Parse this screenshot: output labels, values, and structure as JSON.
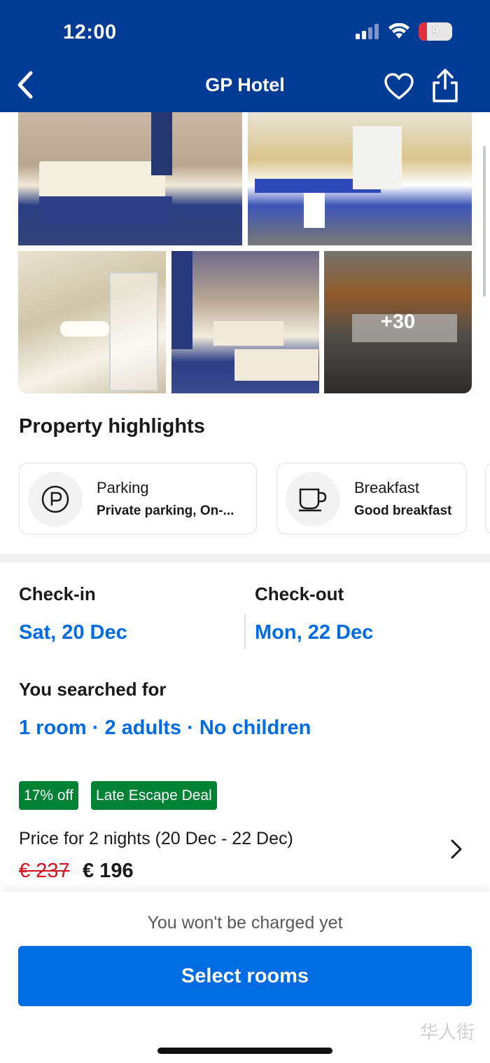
{
  "status_bar": {
    "time": "12:00",
    "battery": "9"
  },
  "header": {
    "title": "GP Hotel"
  },
  "gallery": {
    "more_count": "+30"
  },
  "highlights": {
    "title": "Property highlights",
    "items": [
      {
        "icon": "parking-icon",
        "name": "Parking",
        "detail": "Private parking, On-..."
      },
      {
        "icon": "coffee-cup-icon",
        "name": "Breakfast",
        "detail": "Good breakfast"
      }
    ]
  },
  "dates": {
    "checkin_label": "Check-in",
    "checkin_value": "Sat, 20 Dec",
    "checkout_label": "Check-out",
    "checkout_value": "Mon, 22 Dec"
  },
  "search": {
    "label": "You searched for",
    "value": "1 room · 2 adults · No children"
  },
  "deal": {
    "badges": [
      "17% off",
      "Late Escape Deal"
    ],
    "price_label": "Price for 2 nights (20 Dec - 22 Dec)",
    "old_price": "€ 237",
    "new_price": "€ 196"
  },
  "footer": {
    "note": "You won't be charged yet",
    "cta": "Select rooms"
  },
  "colors": {
    "brand": "#003b95",
    "accent": "#006ce4",
    "deal_green": "#008234",
    "strike_red": "#d4111e"
  },
  "watermark": "华人街"
}
